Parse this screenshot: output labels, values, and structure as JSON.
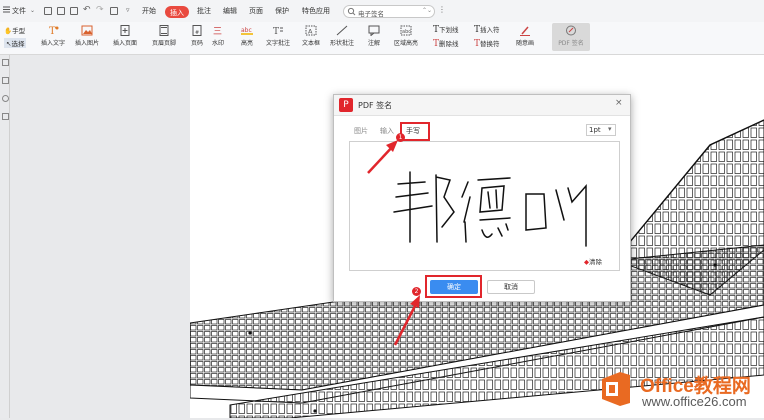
{
  "menubar": {
    "file_label": "文件",
    "tabs": [
      "开始",
      "插入",
      "批注",
      "编辑",
      "页面",
      "保护",
      "特色应用"
    ],
    "active_tab": "插入",
    "search_placeholder": "电子签名"
  },
  "ribbon": {
    "left_tools": [
      "手型",
      "选择"
    ],
    "buttons": [
      "插入文字",
      "插入图片",
      "插入页面",
      "页眉页脚",
      "页码",
      "水印",
      "高亮",
      "文字批注",
      "文本框",
      "形状批注",
      "注解",
      "区域高亮"
    ],
    "small_buttons": [
      "下划线",
      "删除线",
      "插入符",
      "替换符",
      "随意画"
    ],
    "pdf_sign_label": "PDF 签名"
  },
  "dialog": {
    "title": "PDF 签名",
    "tabs": [
      "图片",
      "输入",
      "手写"
    ],
    "active_tab": "手写",
    "pen_size": "1pt",
    "signature_text": "邦德叫",
    "clear_label": "清除",
    "confirm_label": "确定",
    "cancel_label": "取消"
  },
  "annotations": {
    "badge_1": "1",
    "badge_2": "2"
  },
  "watermark": {
    "brand": "Office教程网",
    "url": "www.office26.com"
  },
  "colors": {
    "accent_red": "#e1262c",
    "primary_blue": "#3a8cf0",
    "brand_orange": "#e96a22"
  }
}
